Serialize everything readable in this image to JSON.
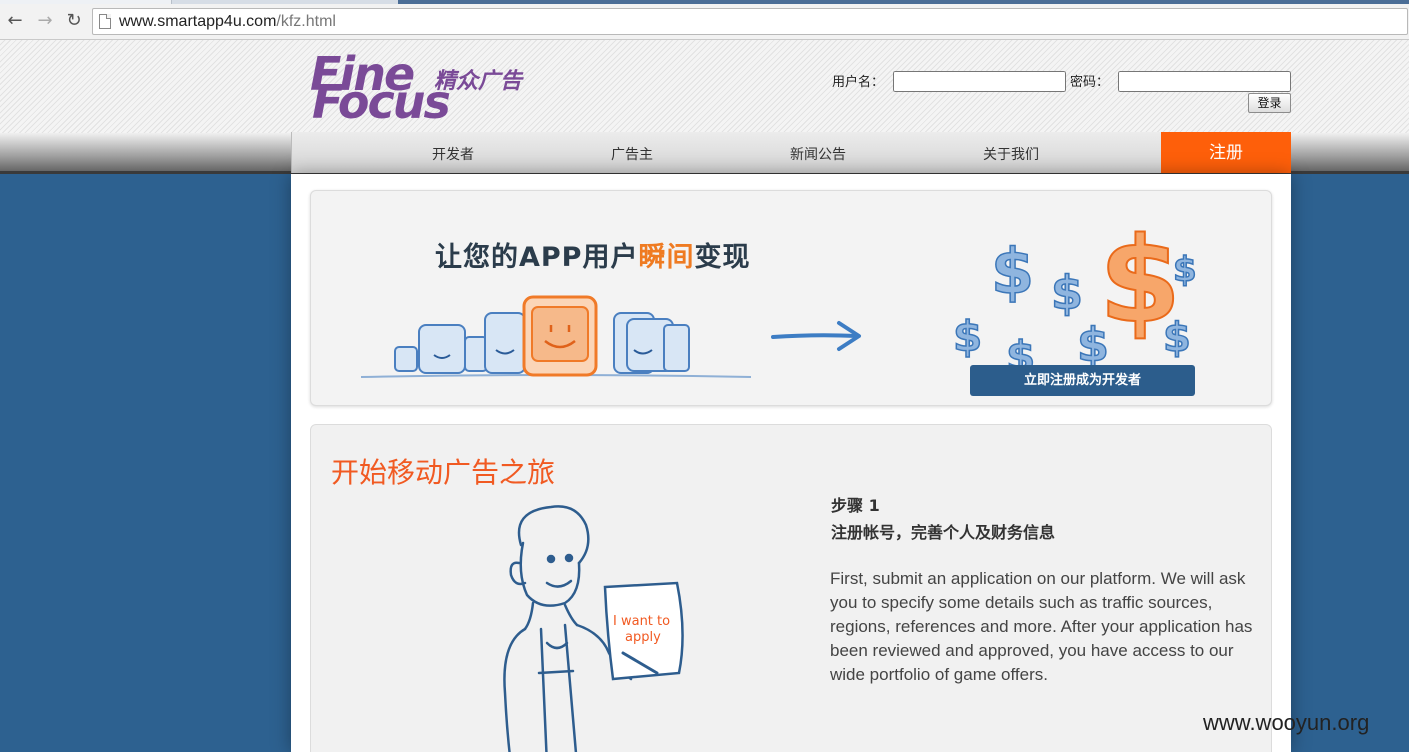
{
  "browser": {
    "url_domain": "www.smartapp4u.com",
    "url_path": "/kfz.html"
  },
  "header": {
    "logo_fine": "Fine",
    "logo_focus": "Focus",
    "logo_cn": "精众广告",
    "username_label": "用户名：",
    "password_label": "密码：",
    "login_button": "登录"
  },
  "nav": {
    "items": [
      "开发者",
      "广告主",
      "新闻公告",
      "关于我们"
    ],
    "register": "注册"
  },
  "banner": {
    "slogan_a": "让您的APP用户",
    "slogan_b": "瞬间",
    "slogan_c": "变现",
    "cta": "立即注册成为开发者"
  },
  "journey": {
    "title": "开始移动广告之旅",
    "sign_text_1": "I want to",
    "sign_text_2": "apply",
    "step_label": "步骤 1",
    "step_title": "注册帐号，完善个人及财务信息",
    "description": "First, submit an application on our platform. We will ask you to specify some details such as traffic sources, regions, references and more. After your application has been reviewed and approved, you have access to our wide portfolio of game offers."
  },
  "watermark": "www.wooyun.org",
  "colors": {
    "page_bg": "#2d6190",
    "brand_purple": "#7a4a97",
    "accent_orange": "#fe5f0a",
    "cta_blue": "#2c5d8c"
  }
}
